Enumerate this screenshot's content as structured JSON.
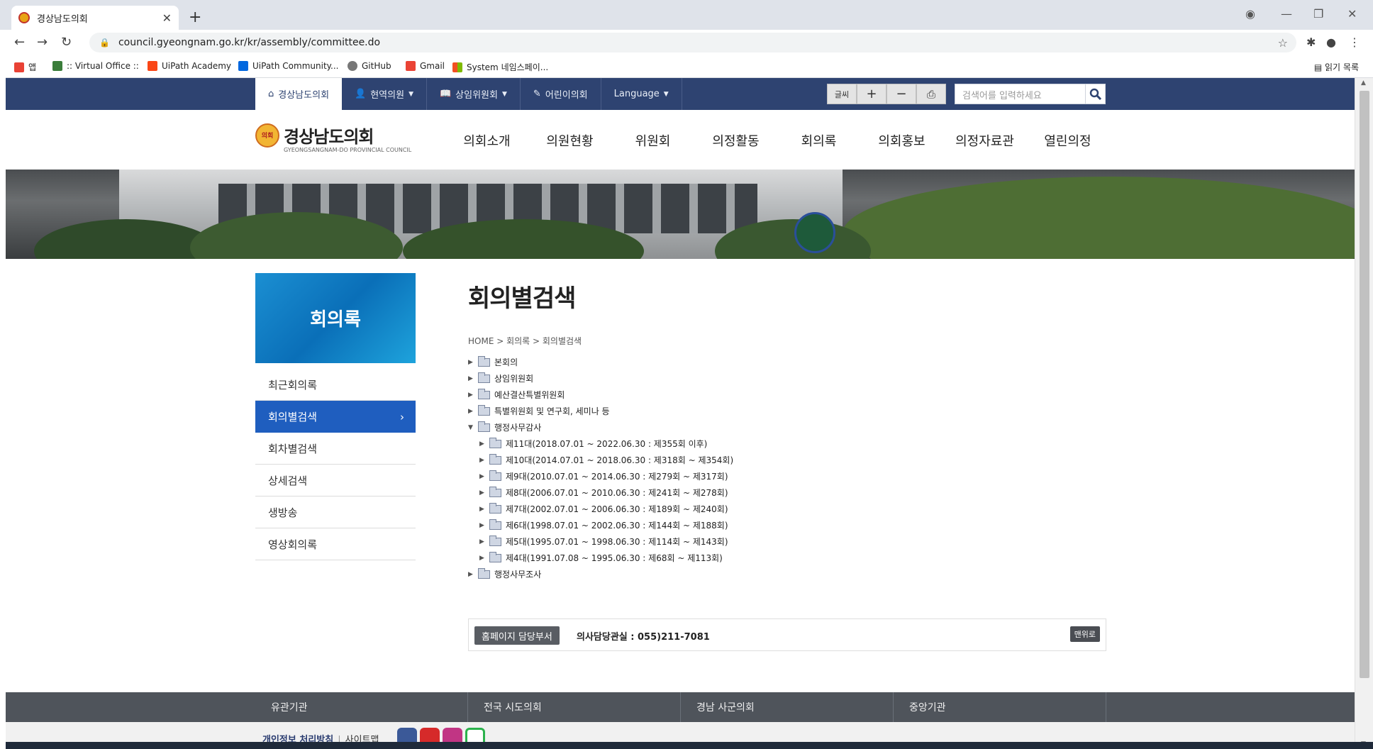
{
  "browser": {
    "tab_title": "경상남도의회",
    "url": "council.gyeongnam.go.kr/kr/assembly/committee.do",
    "bookmarks": [
      "앱",
      ":: Virtual Office ::",
      "UiPath Academy",
      "UiPath Community...",
      "GitHub",
      "Gmail",
      "System 네임스페이..."
    ],
    "reading_list": "읽기 목록"
  },
  "topnav": {
    "items": [
      "경상남도의회",
      "현역의원",
      "상임위원회",
      "어린이의회",
      "Language"
    ],
    "font_label": "글씨",
    "search_placeholder": "검색어를 입력하세요"
  },
  "logo": {
    "emblem_text": "의회",
    "name": "경상남도의회",
    "subtitle": "GYEONGSANGNAM-DO PROVINCIAL COUNCIL"
  },
  "main_menu": [
    "의회소개",
    "의원현황",
    "위원회",
    "의정활동",
    "회의록",
    "의회홍보",
    "의정자료관",
    "열린의정"
  ],
  "sidebar": {
    "title": "회의록",
    "items": [
      "최근회의록",
      "회의별검색",
      "회차별검색",
      "상세검색",
      "생방송",
      "영상회의록"
    ],
    "active_index": 1
  },
  "content": {
    "title": "회의별검색",
    "breadcrumb": "HOME > 회의록 > 회의별검색",
    "tree": [
      {
        "label": "본회의",
        "expanded": false
      },
      {
        "label": "상임위원회",
        "expanded": false
      },
      {
        "label": "예산결산특별위원회",
        "expanded": false
      },
      {
        "label": "특별위원회 및 연구회, 세미나 등",
        "expanded": false
      },
      {
        "label": "행정사무감사",
        "expanded": true,
        "children": [
          "제11대(2018.07.01 ~ 2022.06.30 : 제355회 이후)",
          "제10대(2014.07.01 ~ 2018.06.30 : 제318회 ~ 제354회)",
          "제9대(2010.07.01 ~ 2014.06.30 : 제279회 ~ 제317회)",
          "제8대(2006.07.01 ~ 2010.06.30 : 제241회 ~ 제278회)",
          "제7대(2002.07.01 ~ 2006.06.30 : 제189회 ~ 제240회)",
          "제6대(1998.07.01 ~ 2002.06.30 : 제144회 ~ 제188회)",
          "제5대(1995.07.01 ~ 1998.06.30 : 제114회 ~ 제143회)",
          "제4대(1991.07.08 ~ 1995.06.30 : 제68회 ~ 제113회)"
        ]
      },
      {
        "label": "행정사무조사",
        "expanded": false
      }
    ]
  },
  "contact": {
    "dept_label": "홈페이지 담당부서",
    "tel": "의사담당관실 : 055)211-7081",
    "top_label": "맨위로"
  },
  "footer": {
    "columns": [
      "유관기관",
      "전국 시도의회",
      "경남 사군의회",
      "중앙기관"
    ],
    "privacy": "개인정보 처리방침",
    "sitemap": "사이트맵"
  },
  "colors": {
    "navy": "#2e4371",
    "active_blue": "#1f5ebf",
    "hero_blue": "#0a6fb8"
  }
}
